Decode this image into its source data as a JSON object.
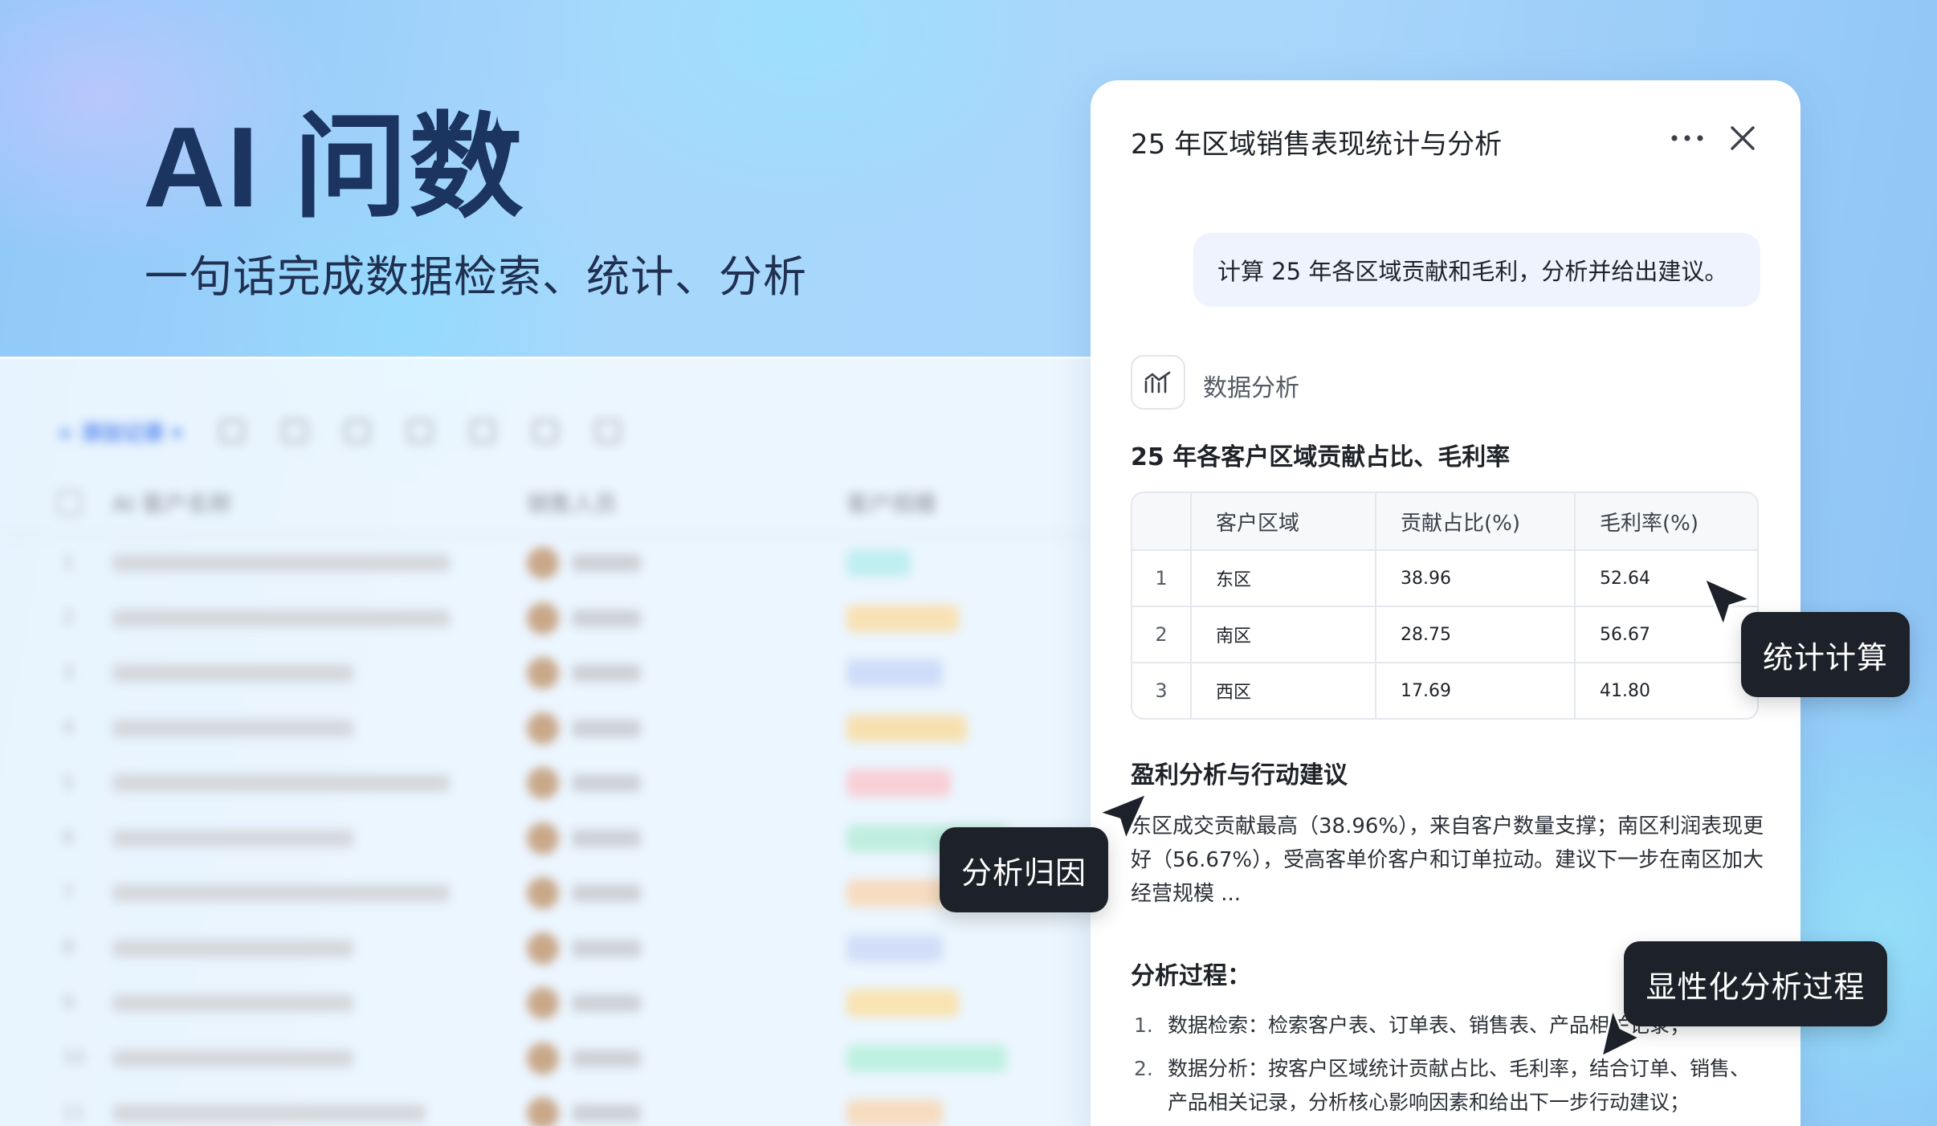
{
  "hero": {
    "title": "AI 问数",
    "subtitle": "一句话完成数据检索、统计、分析"
  },
  "background_table": {
    "toolbar_add_label": "添加记录",
    "columns": [
      "AI 客户名称",
      "销售人员",
      "客户规模"
    ],
    "row_count": 11,
    "tag_colors": [
      "#bfeef1",
      "#f8e1b4",
      "#cfdcf8",
      "#f7e0b0",
      "#f8cfd6",
      "#bfeedf",
      "#f6dcc0",
      "#d2def8",
      "#f8e3b2",
      "#bff0e1",
      "#f6dcc0"
    ]
  },
  "panel": {
    "title": "25 年区域销售表现统计与分析",
    "user_message": "计算 25 年各区域贡献和毛利，分析并给出建议。",
    "step_icon": "line-chart-icon",
    "step_label": "数据分析",
    "table_title": "25 年各客户区域贡献占比、毛利率",
    "table_headers": [
      "客户区域",
      "贡献占比(%)",
      "毛利率(%)"
    ],
    "table_rows": [
      {
        "idx": "1",
        "region": "东区",
        "share": "38.96",
        "margin": "52.64"
      },
      {
        "idx": "2",
        "region": "南区",
        "share": "28.75",
        "margin": "56.67"
      },
      {
        "idx": "3",
        "region": "西区",
        "share": "17.69",
        "margin": "41.80"
      }
    ],
    "analysis_title": "盈利分析与行动建议",
    "analysis_text": "东区成交贡献最高（38.96%），来自客户数量支撑；南区利润表现更好（56.67%），受高客单价客户和订单拉动。建议下一步在南区加大经营规模 ...",
    "process_title": "分析过程：",
    "process_steps": [
      {
        "n": "1.",
        "text": "数据检索：检索客户表、订单表、销售表、产品相关记录；"
      },
      {
        "n": "2.",
        "text": "数据分析：按客户区域统计贡献占比、毛利率，结合订单、销售、产品相关记录，分析核心影响因素和给出下一步行动建议；"
      }
    ]
  },
  "tooltips": {
    "stat": "统计计算",
    "attribution": "分析归因",
    "process": "显性化分析过程"
  }
}
